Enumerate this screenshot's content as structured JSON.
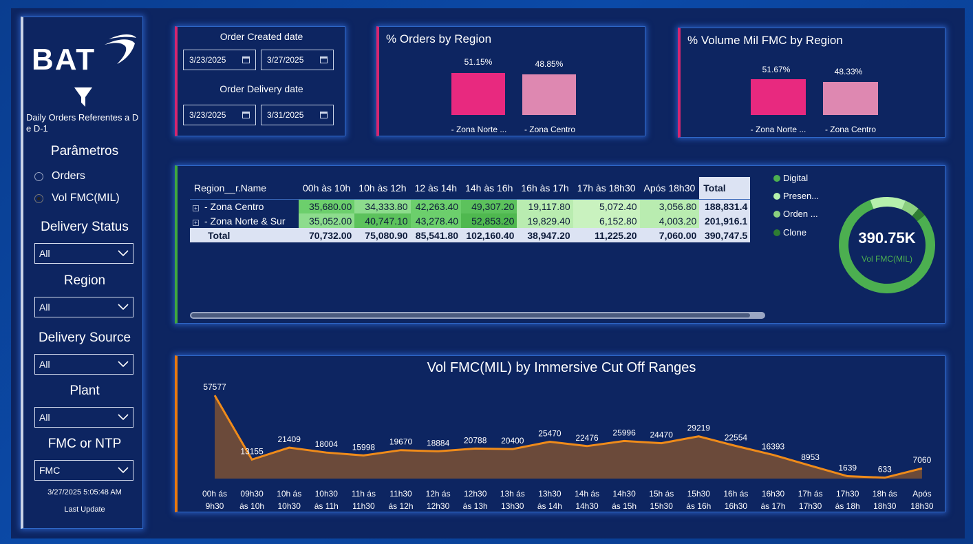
{
  "sidebar": {
    "subtitle": "Daily Orders Referentes a D e D-1",
    "parametros_label": "Parâmetros",
    "radio_options": [
      {
        "label": "Orders",
        "selected": false
      },
      {
        "label": "Vol FMC(MIL)",
        "selected": true
      }
    ],
    "filters": [
      {
        "label": "Delivery Status",
        "value": "All"
      },
      {
        "label": "Region",
        "value": "All"
      },
      {
        "label": "Delivery Source",
        "value": "All"
      },
      {
        "label": "Plant",
        "value": "All"
      },
      {
        "label": "FMC or NTP",
        "value": "FMC"
      }
    ],
    "last_update_time": "3/27/2025 5:05:48 AM",
    "last_update_label": "Last Update"
  },
  "dates": {
    "created_label": "Order Created date",
    "created_from": "3/23/2025",
    "created_to": "3/27/2025",
    "delivery_label": "Order Delivery date",
    "delivery_from": "3/23/2025",
    "delivery_to": "3/31/2025"
  },
  "orders_by_region": {
    "title": "% Orders by Region",
    "bars": [
      {
        "category": "- Zona Norte ...",
        "value_label": "51.15%",
        "value": 51.15,
        "color": "#e8297f"
      },
      {
        "category": "- Zona Centro",
        "value_label": "48.85%",
        "value": 48.85,
        "color": "#de88b1"
      }
    ]
  },
  "volume_by_region": {
    "title": "% Volume Mil FMC by Region",
    "bars": [
      {
        "category": "- Zona Norte ...",
        "value_label": "51.67%",
        "value": 51.67,
        "color": "#e8297f"
      },
      {
        "category": "- Zona Centro",
        "value_label": "48.33%",
        "value": 48.33,
        "color": "#de88b1"
      }
    ]
  },
  "matrix": {
    "headers": [
      "Region__r.Name",
      "00h às 10h",
      "10h às 12h",
      "12 às 14h",
      "14h às 16h",
      "16h às 17h",
      "17h às 18h30",
      "Após 18h30",
      "Total"
    ],
    "rows": [
      {
        "name": "- Zona Centro",
        "cells": [
          "35,680.00",
          "34,333.80",
          "42,263.40",
          "49,307.20",
          "19,117.80",
          "5,072.40",
          "3,056.80"
        ],
        "total": "188,831.4",
        "expand": "+"
      },
      {
        "name": "- Zona Norte & Sur",
        "cells": [
          "35,052.00",
          "40,747.10",
          "43,278.40",
          "52,853.20",
          "19,829.40",
          "6,152.80",
          "4,003.20"
        ],
        "total": "201,916.1",
        "expand": "+"
      }
    ],
    "total_row": {
      "name": "Total",
      "cells": [
        "70,732.00",
        "75,080.90",
        "85,541.80",
        "102,160.40",
        "38,947.20",
        "11,225.20",
        "7,060.00"
      ],
      "total": "390,747.5"
    },
    "cell_colors": [
      [
        "#6ccf6c",
        "#8ddc8d",
        "#6ccf6c",
        "#5cc25c",
        "#b9ecb0",
        "#c9f2bf",
        "#b9ecb0"
      ],
      [
        "#8ddc8d",
        "#5cc25c",
        "#6ccf6c",
        "#4fb84f",
        "#b9ecb0",
        "#c9f2bf",
        "#b9ecb0"
      ]
    ]
  },
  "donut": {
    "value": "390.75K",
    "label": "Vol FMC(MIL)",
    "legend": [
      {
        "label": "Digital",
        "color": "#4caf50"
      },
      {
        "label": "Presen...",
        "color": "#b5f0ac"
      },
      {
        "label": "Orden ...",
        "color": "#8bd07f"
      },
      {
        "label": "Clone",
        "color": "#2e7d32"
      }
    ],
    "shares": [
      0.8,
      0.12,
      0.05,
      0.03
    ]
  },
  "chart_data": {
    "type": "area",
    "title": "Vol FMC(MIL) by Immersive Cut Off Ranges",
    "categories": [
      [
        "00h ás",
        "9h30"
      ],
      [
        "09h30",
        "ás 10h"
      ],
      [
        "10h ás",
        "10h30"
      ],
      [
        "10h30",
        "ás 11h"
      ],
      [
        "11h ás",
        "11h30"
      ],
      [
        "11h30",
        "ás 12h"
      ],
      [
        "12h ás",
        "12h30"
      ],
      [
        "12h30",
        "ás 13h"
      ],
      [
        "13h ás",
        "13h30"
      ],
      [
        "13h30",
        "ás 14h"
      ],
      [
        "14h ás",
        "14h30"
      ],
      [
        "14h30",
        "ás 15h"
      ],
      [
        "15h ás",
        "15h30"
      ],
      [
        "15h30",
        "ás 16h"
      ],
      [
        "16h ás",
        "16h30"
      ],
      [
        "16h30",
        "ás 17h"
      ],
      [
        "17h ás",
        "17h30"
      ],
      [
        "17h30",
        "ás 18h"
      ],
      [
        "18h ás",
        "18h30"
      ],
      [
        "Após",
        "18h30"
      ]
    ],
    "values": [
      57577,
      13155,
      21409,
      18004,
      15998,
      19670,
      18884,
      20788,
      20400,
      25470,
      22476,
      25996,
      24470,
      29219,
      22554,
      16393,
      8953,
      1639,
      633,
      7060
    ],
    "line_color": "#ef8b1a",
    "fill_color": "#6b4a3a",
    "ylim": [
      0,
      60000
    ]
  }
}
